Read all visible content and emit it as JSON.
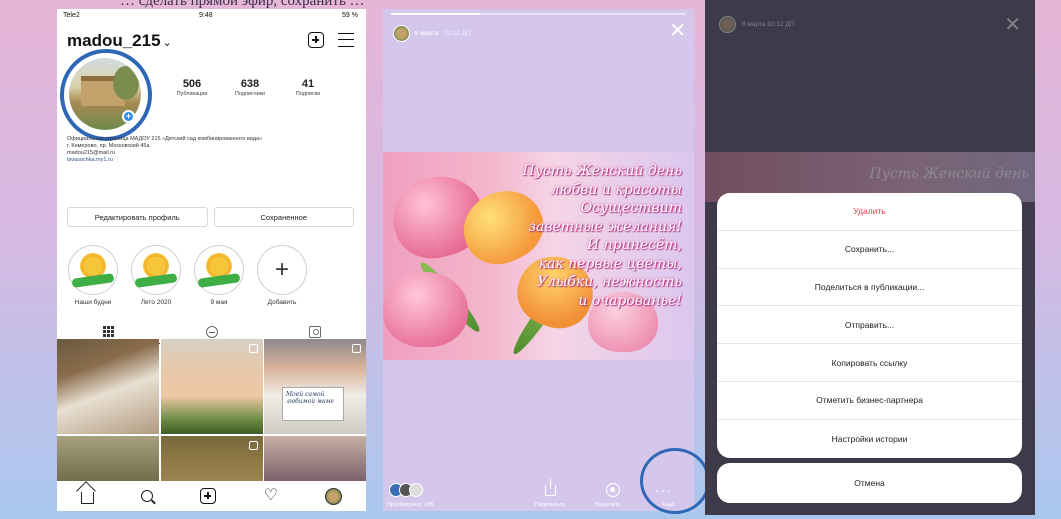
{
  "caption": "… сделать прямой эфир, сохранить …",
  "profile": {
    "status": {
      "carrier": "Tele2",
      "time": "9:48",
      "battery": "59 %"
    },
    "username": "madou_215",
    "stats": [
      {
        "count": "506",
        "label": "Публикации"
      },
      {
        "count": "638",
        "label": "Подписчики"
      },
      {
        "count": "41",
        "label": "Подписки"
      }
    ],
    "bio": [
      "Официальная страница МАДОУ 215 «Детский сад комбинированного вида»",
      "г. Кемерово, пр. Московский 45а",
      "madou215@mail.ru",
      "lavasochka.my1.ru"
    ],
    "buttons": {
      "edit": "Редактировать профиль",
      "saved": "Сохраненное"
    },
    "highlights": [
      "Наши будни",
      "Лето 2020",
      "9 мая",
      "Добавить"
    ],
    "photo_note": "Моей самой любимой маме"
  },
  "story": {
    "user": "8 марта",
    "time": "10:12 ДП",
    "progress": 0.3,
    "verse": [
      "Пусть Женский день",
      "любви и красоты",
      "Осуществит",
      "заветные желания!",
      "И принесёт,",
      "как первые цветы,",
      "Улыбки, нежность",
      "и очарованье!"
    ],
    "footer": {
      "viewers": "Просмотрено: 186",
      "share": "Поделиться",
      "highlight": "Выделить",
      "more": "Ещё"
    }
  },
  "sheet": {
    "header_user": "8 марта  10:12 ДП",
    "card_verse": "Пусть Женский день",
    "items": [
      "Удалить",
      "Сохранить...",
      "Поделиться в публикации...",
      "Отправить...",
      "Копировать ссылку",
      "Отметить бизнес-партнера",
      "Настройки истории"
    ],
    "cancel": "Отмена"
  },
  "colors": {
    "highlight_ring": "#2f67b7",
    "danger": "#e0394b",
    "link": "#2d4f86"
  }
}
